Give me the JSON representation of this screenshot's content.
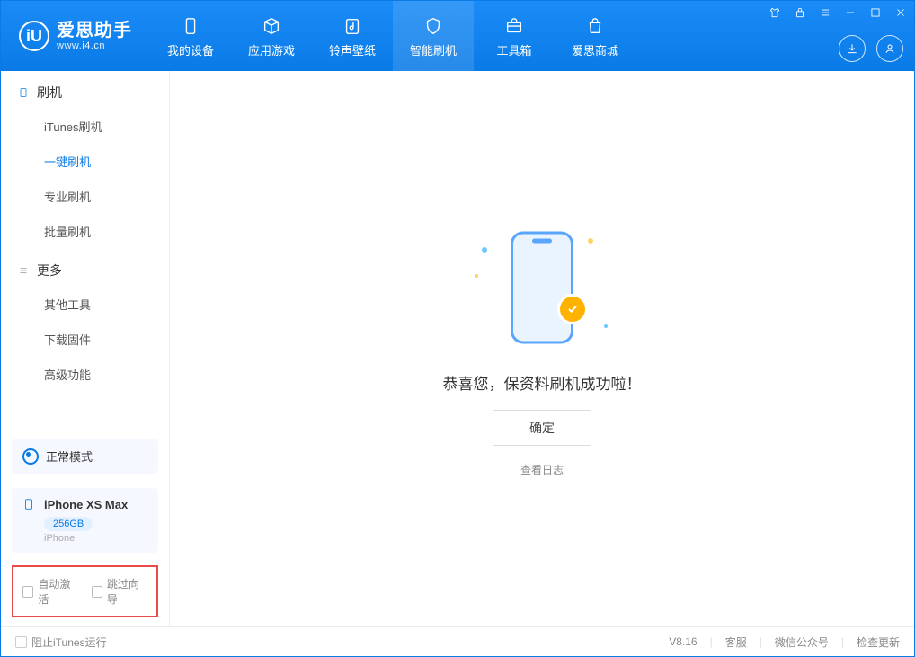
{
  "header": {
    "logo_title": "爱思助手",
    "logo_url": "www.i4.cn",
    "nav": [
      {
        "label": "我的设备",
        "icon": "device"
      },
      {
        "label": "应用游戏",
        "icon": "cube"
      },
      {
        "label": "铃声壁纸",
        "icon": "music"
      },
      {
        "label": "智能刷机",
        "icon": "shield",
        "active": true
      },
      {
        "label": "工具箱",
        "icon": "toolbox"
      },
      {
        "label": "爱思商城",
        "icon": "bag"
      }
    ]
  },
  "sidebar": {
    "section1": {
      "title": "刷机",
      "items": [
        {
          "label": "iTunes刷机"
        },
        {
          "label": "一键刷机",
          "active": true
        },
        {
          "label": "专业刷机"
        },
        {
          "label": "批量刷机"
        }
      ]
    },
    "section2": {
      "title": "更多",
      "items": [
        {
          "label": "其他工具"
        },
        {
          "label": "下载固件"
        },
        {
          "label": "高级功能"
        }
      ]
    },
    "mode": "正常模式",
    "device": {
      "name": "iPhone XS Max",
      "capacity": "256GB",
      "type": "iPhone"
    },
    "options": {
      "auto_activate": "自动激活",
      "skip_guide": "跳过向导"
    }
  },
  "main": {
    "success": "恭喜您，保资料刷机成功啦！",
    "ok": "确定",
    "view_log": "查看日志"
  },
  "footer": {
    "block_itunes": "阻止iTunes运行",
    "version": "V8.16",
    "service": "客服",
    "wechat": "微信公众号",
    "check_update": "检查更新"
  }
}
